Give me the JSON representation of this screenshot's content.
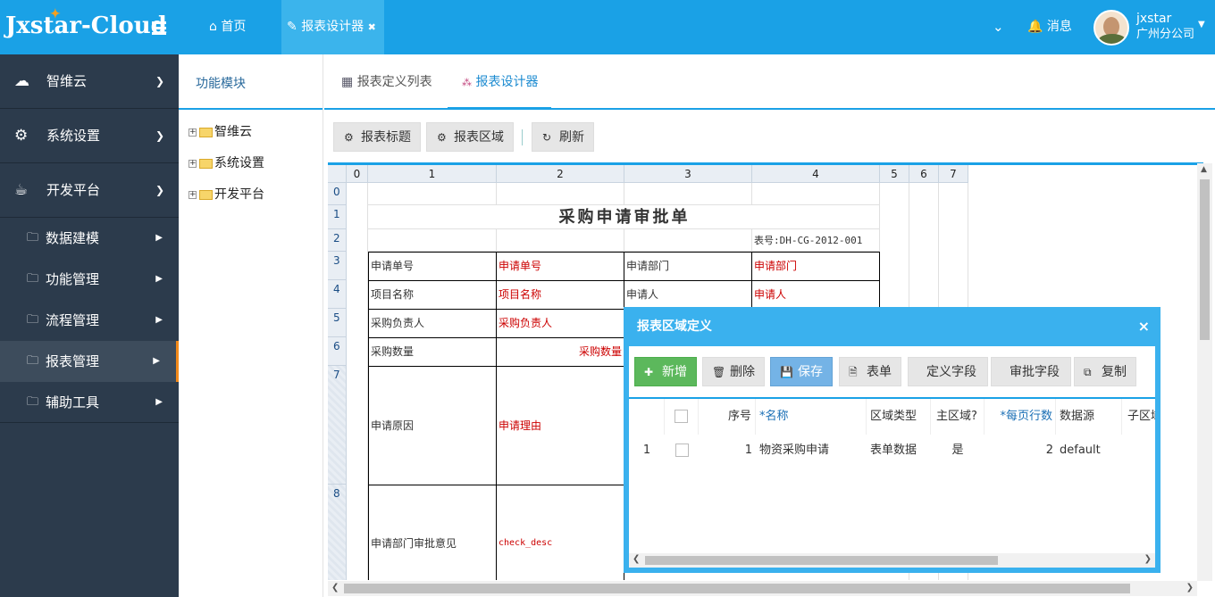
{
  "app": {
    "title": "Jxstar-Cloud"
  },
  "top_tabs": [
    {
      "label": "首页",
      "icon": "home-icon"
    },
    {
      "label": "报表设计器",
      "icon": "edit-icon",
      "close": "✖"
    }
  ],
  "header_right": {
    "messages": "消息",
    "user_name": "jxstar",
    "company": "广州分公司"
  },
  "sidebar": {
    "sections": [
      {
        "label": "智维云",
        "icon": "cloud-icon"
      },
      {
        "label": "系统设置",
        "icon": "gears-icon"
      },
      {
        "label": "开发平台",
        "icon": "coffee-icon"
      }
    ],
    "items": [
      {
        "label": "数据建模"
      },
      {
        "label": "功能管理"
      },
      {
        "label": "流程管理"
      },
      {
        "label": "报表管理",
        "active": true
      },
      {
        "label": "辅助工具"
      }
    ]
  },
  "tree": {
    "title": "功能模块",
    "nodes": [
      "智维云",
      "系统设置",
      "开发平台"
    ]
  },
  "main_tabs": [
    {
      "label": "报表定义列表",
      "icon": "table-icon"
    },
    {
      "label": "报表设计器",
      "icon": "designer-icon",
      "active": true
    }
  ],
  "toolbar": {
    "report_title": "报表标题",
    "report_area": "报表区域",
    "refresh": "刷新"
  },
  "sheet": {
    "col_headers": [
      "0",
      "1",
      "2",
      "3",
      "4",
      "5",
      "6",
      "7"
    ],
    "row_headers": [
      "0",
      "1",
      "2",
      "3",
      "4",
      "5",
      "6",
      "7",
      "8"
    ],
    "title": "采购申请审批单",
    "form_no": "表号:DH-CG-2012-001",
    "cells": {
      "r3c1": "申请单号",
      "r3c2": "申请单号",
      "r3c3": "申请部门",
      "r3c4": "申请部门",
      "r4c1": "项目名称",
      "r4c2": "项目名称",
      "r4c3": "申请人",
      "r4c4": "申请人",
      "r5c1": "采购负责人",
      "r5c2": "采购负责人",
      "r6c1": "采购数量",
      "r6c2": "采购数量",
      "r7c1": "申请原因",
      "r7c2": "申请理由",
      "r8c1": "申请部门审批意见",
      "r8c2": "check_desc"
    }
  },
  "dialog": {
    "title": "报表区域定义",
    "close": "×",
    "buttons": {
      "add": "新增",
      "delete": "删除",
      "save": "保存",
      "form": "表单",
      "define_fields": "定义字段",
      "approve_fields": "审批字段",
      "copy": "复制"
    },
    "columns": {
      "seq": "序号",
      "name": "*名称",
      "area_type": "区域类型",
      "main_area": "主区域?",
      "rows_per_page": "*每页行数",
      "data_source": "数据源",
      "sub_area": "子区域"
    },
    "rows": [
      {
        "row_num": "1",
        "seq": "1",
        "name": "物资采购申请",
        "area_type": "表单数据",
        "main_area": "是",
        "rows_per_page": "2",
        "data_source": "default"
      }
    ]
  }
}
